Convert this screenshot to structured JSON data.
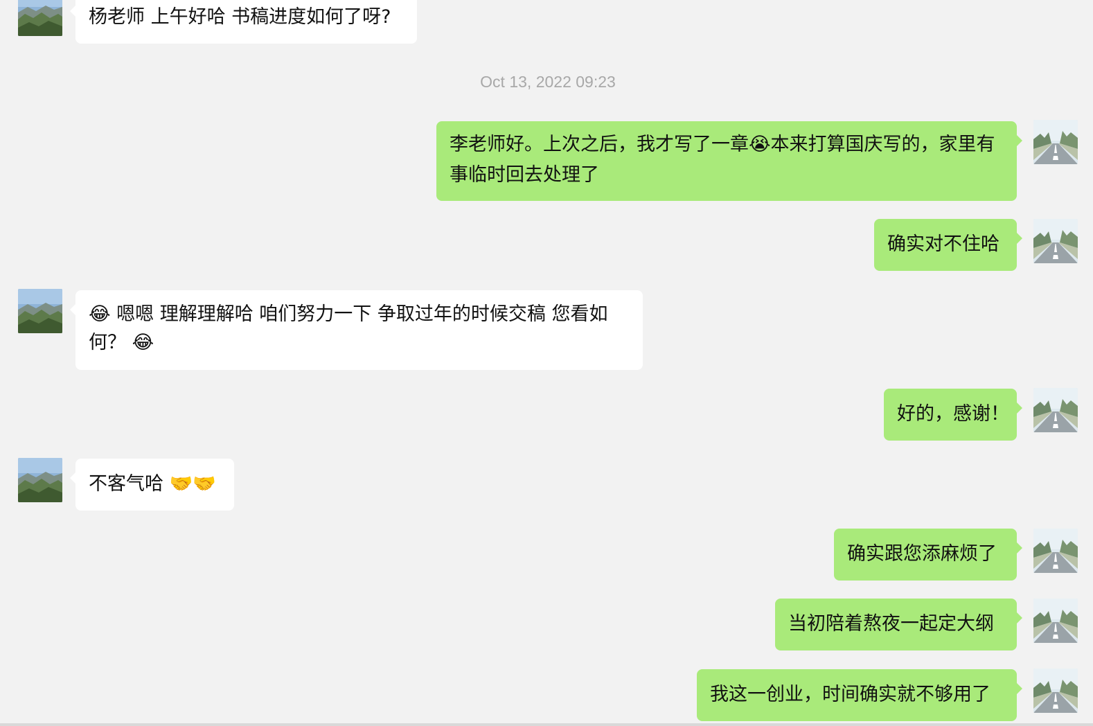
{
  "conversation": {
    "timestamp": "Oct 13, 2022 09:23",
    "messages": [
      {
        "sender": "contact",
        "text": "杨老师 上午好哈 书稿进度如何了呀?"
      },
      {
        "sender": "me",
        "text": "李老师好。上次之后，我才写了一章😭本来打算国庆写的，家里有事临时回去处理了"
      },
      {
        "sender": "me",
        "text": "确实对不住哈"
      },
      {
        "sender": "contact",
        "text": "😂 嗯嗯 理解理解哈 咱们努力一下 争取过年的时候交稿 您看如何？ 😂"
      },
      {
        "sender": "me",
        "text": "好的，感谢！"
      },
      {
        "sender": "contact",
        "text": "不客气哈 🤝🤝"
      },
      {
        "sender": "me",
        "text": "确实跟您添麻烦了"
      },
      {
        "sender": "me",
        "text": "当初陪着熬夜一起定大纲"
      },
      {
        "sender": "me",
        "text": "我这一创业，时间确实就不够用了"
      }
    ]
  },
  "avatars": {
    "contact": "mountain-landscape-avatar",
    "me": "tree-lined-road-avatar"
  },
  "colors": {
    "background": "#f2f2f2",
    "incoming_bubble": "#ffffff",
    "outgoing_bubble": "#a9ea7a",
    "timestamp_text": "#a8a8a8"
  }
}
